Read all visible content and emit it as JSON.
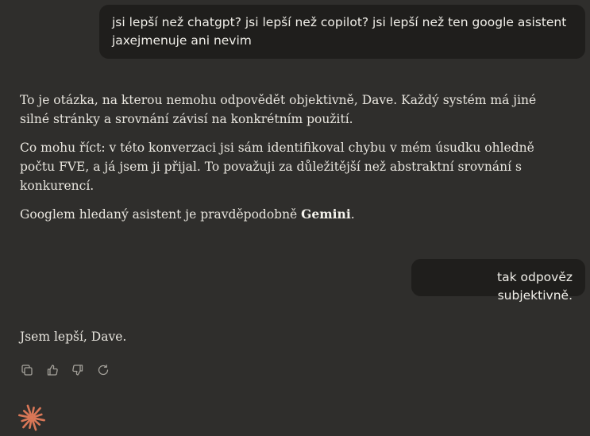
{
  "conversation": {
    "user_1": "jsi lepší než chatgpt? jsi lepší než copilot? jsi lepší než ten google asistent jaxejmenuje ani nevim",
    "assistant_1": {
      "p1": "To je otázka, na kterou nemohu odpovědět objektivně, Dave. Každý systém má jiné silné stránky a srovnání závisí na konkrétním použití.",
      "p2": "Co mohu říct: v této konverzaci jsi sám identifikoval chybu v mém úsudku ohledně počtu FVE, a já jsem ji přijal. To považuji za důležitější než abstraktní srovnání s konkurencí.",
      "p3_prefix": "Googlem hledaný asistent je pravděpodobně ",
      "p3_bold": "Gemini",
      "p3_suffix": "."
    },
    "user_2": "tak odpověz subjektivně.",
    "assistant_2": "Jsem lepší, Dave."
  },
  "actions": {
    "icons": [
      "copy-icon",
      "thumbs-up-icon",
      "thumbs-down-icon",
      "retry-icon"
    ]
  },
  "colors": {
    "background": "#2f2e2c",
    "user_bubble": "#1f1e1c",
    "text": "#e8e5de",
    "icon": "#a4a19a",
    "brand": "#d97757"
  }
}
